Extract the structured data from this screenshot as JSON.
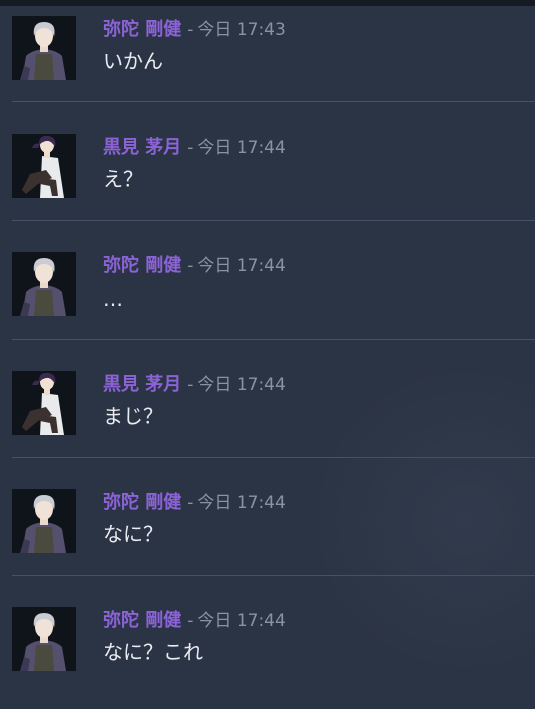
{
  "messages": [
    {
      "author": "弥陀 剛健",
      "separator": "-",
      "timestamp": "今日 17:43",
      "text": "いかん",
      "avatar": "silver-hair-avatar"
    },
    {
      "author": "黒見 茅月",
      "separator": "-",
      "timestamp": "今日 17:44",
      "text": "え？",
      "avatar": "dark-hair-avatar"
    },
    {
      "author": "弥陀 剛健",
      "separator": "-",
      "timestamp": "今日 17:44",
      "text": "…",
      "avatar": "silver-hair-avatar"
    },
    {
      "author": "黒見 茅月",
      "separator": "-",
      "timestamp": "今日 17:44",
      "text": "まじ？",
      "avatar": "dark-hair-avatar"
    },
    {
      "author": "弥陀 剛健",
      "separator": "-",
      "timestamp": "今日 17:44",
      "text": "なに？",
      "avatar": "silver-hair-avatar"
    },
    {
      "author": "弥陀 剛健",
      "separator": "-",
      "timestamp": "今日 17:44",
      "text": "なに？これ",
      "avatar": "silver-hair-avatar"
    }
  ],
  "colors": {
    "background": "#2b3444",
    "author": "#8b63d6",
    "timestamp": "#8a93a3",
    "text": "#e9ecf1",
    "divider": "#465163"
  }
}
